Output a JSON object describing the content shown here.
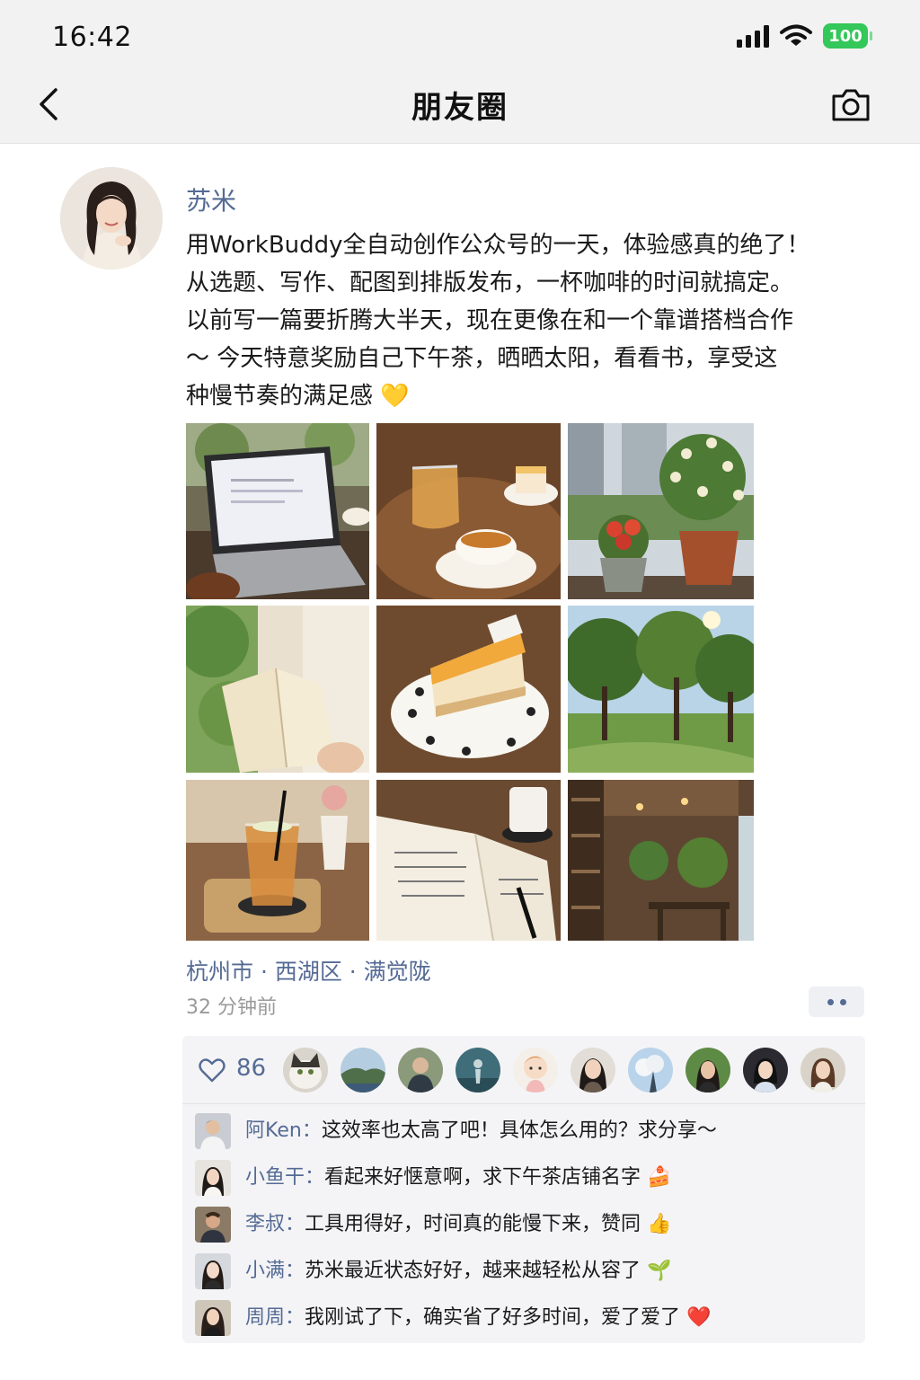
{
  "status_bar": {
    "time": "16:42",
    "battery": "100"
  },
  "header": {
    "title": "朋友圈"
  },
  "post": {
    "author": "苏米",
    "text_lines": [
      "用WorkBuddy全自动创作公众号的一天，体验感真的绝了！",
      "从选题、写作、配图到排版发布，一杯咖啡的时间就搞定。",
      "以前写一篇要折腾大半天，现在更像在和一个靠谱搭档合作",
      "～ 今天特意奖励自己下午茶，晒晒太阳，看看书，享受这",
      "种慢节奏的满足感 💛"
    ],
    "photos": [
      "laptop-on-cafe-table",
      "tea-and-cake",
      "potted-flowers",
      "reading-book",
      "cheesecake-slice",
      "park-trees",
      "iced-tea",
      "notebook-and-coffee",
      "cafe-interior"
    ],
    "location": "杭州市 · 西湖区 · 满觉陇",
    "time_ago": "32 分钟前"
  },
  "likes": {
    "count": "86"
  },
  "comments": [
    {
      "name": "阿Ken",
      "sep": "：",
      "text": "这效率也太高了吧！具体怎么用的？求分享～"
    },
    {
      "name": "小鱼干",
      "sep": "：",
      "text": "看起来好惬意啊，求下午茶店铺名字 🍰"
    },
    {
      "name": "李叔",
      "sep": "：",
      "text": "工具用得好，时间真的能慢下来，赞同 👍"
    },
    {
      "name": "小满",
      "sep": "：",
      "text": "苏米最近状态好好，越来越轻松从容了 🌱"
    },
    {
      "name": "周周",
      "sep": "：",
      "text": "我刚试了下，确实省了好多时间，爱了爱了 ❤️"
    }
  ]
}
